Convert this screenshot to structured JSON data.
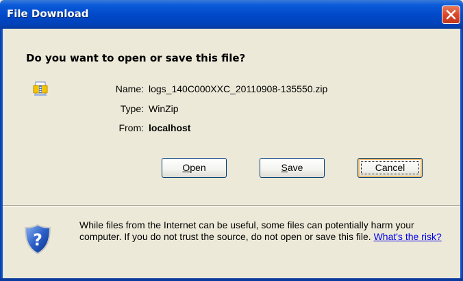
{
  "window": {
    "title": "File Download"
  },
  "dialog": {
    "question": "Do you want to open or save this file?",
    "file_icon": "winzip-file-icon",
    "name_label": "Name:",
    "name_value": "logs_140C000XXC_20110908-135550.zip",
    "type_label": "Type:",
    "type_value": "WinZip",
    "from_label": "From:",
    "from_value": "localhost"
  },
  "buttons": {
    "open_label": "Open",
    "open_rest": "pen",
    "open_mnemonic": "O",
    "save_label": "Save",
    "save_rest": "ave",
    "save_mnemonic": "S",
    "cancel_label": "Cancel"
  },
  "warning": {
    "icon": "shield-question-icon",
    "text": "While files from the Internet can be useful, some files can potentially harm your computer. If you do not trust the source, do not open or save this file.",
    "link_text": "What's the risk?"
  },
  "colors": {
    "titlebar": "#0048c8",
    "close_button": "#d9472a",
    "dialog_bg": "#ece9d8",
    "link": "#0000ee",
    "default_button_highlight": "#f3c071"
  }
}
